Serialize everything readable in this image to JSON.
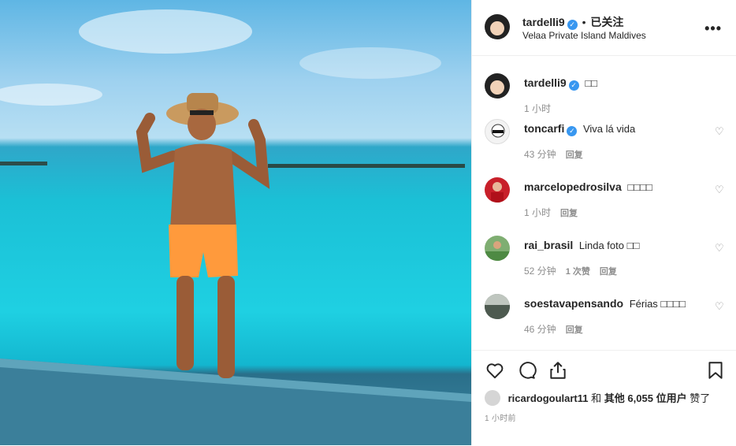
{
  "post": {
    "username": "tardelli9",
    "verified_mark": "✓",
    "follow_sep": "•",
    "follow_status": "已关注",
    "location": "Velaa Private Island Maldives",
    "more_icon": "more-horizontal-icon"
  },
  "caption": {
    "username": "tardelli9",
    "text": "□□",
    "time": "1 小时"
  },
  "comments": [
    {
      "username": "toncarfi",
      "verified": true,
      "text": "Viva lá vida",
      "time": "43 分钟",
      "likes": "",
      "reply": "回复"
    },
    {
      "username": "marcelopedrosilva",
      "verified": false,
      "text": "□□□□",
      "time": "1 小时",
      "likes": "",
      "reply": "回复"
    },
    {
      "username": "rai_brasil",
      "verified": false,
      "text": "Linda foto □□",
      "time": "52 分钟",
      "likes": "1 次赞",
      "reply": "回复"
    },
    {
      "username": "soestavapensando",
      "verified": false,
      "text": "Férias □□□□",
      "time": "46 分钟",
      "likes": "",
      "reply": "回复"
    }
  ],
  "actions": {
    "like_icon": "heart-icon",
    "comment_icon": "comment-icon",
    "share_icon": "share-icon",
    "save_icon": "bookmark-icon"
  },
  "likes": {
    "user": "ricardogoulart11",
    "and": "和",
    "others_label": "其他",
    "count": "6,055",
    "unit": "位用户",
    "suffix": "赞了"
  },
  "timestamp": "1 小时前",
  "colors": {
    "verified": "#3897f0",
    "muted": "#8e8e8e",
    "text": "#262626"
  }
}
